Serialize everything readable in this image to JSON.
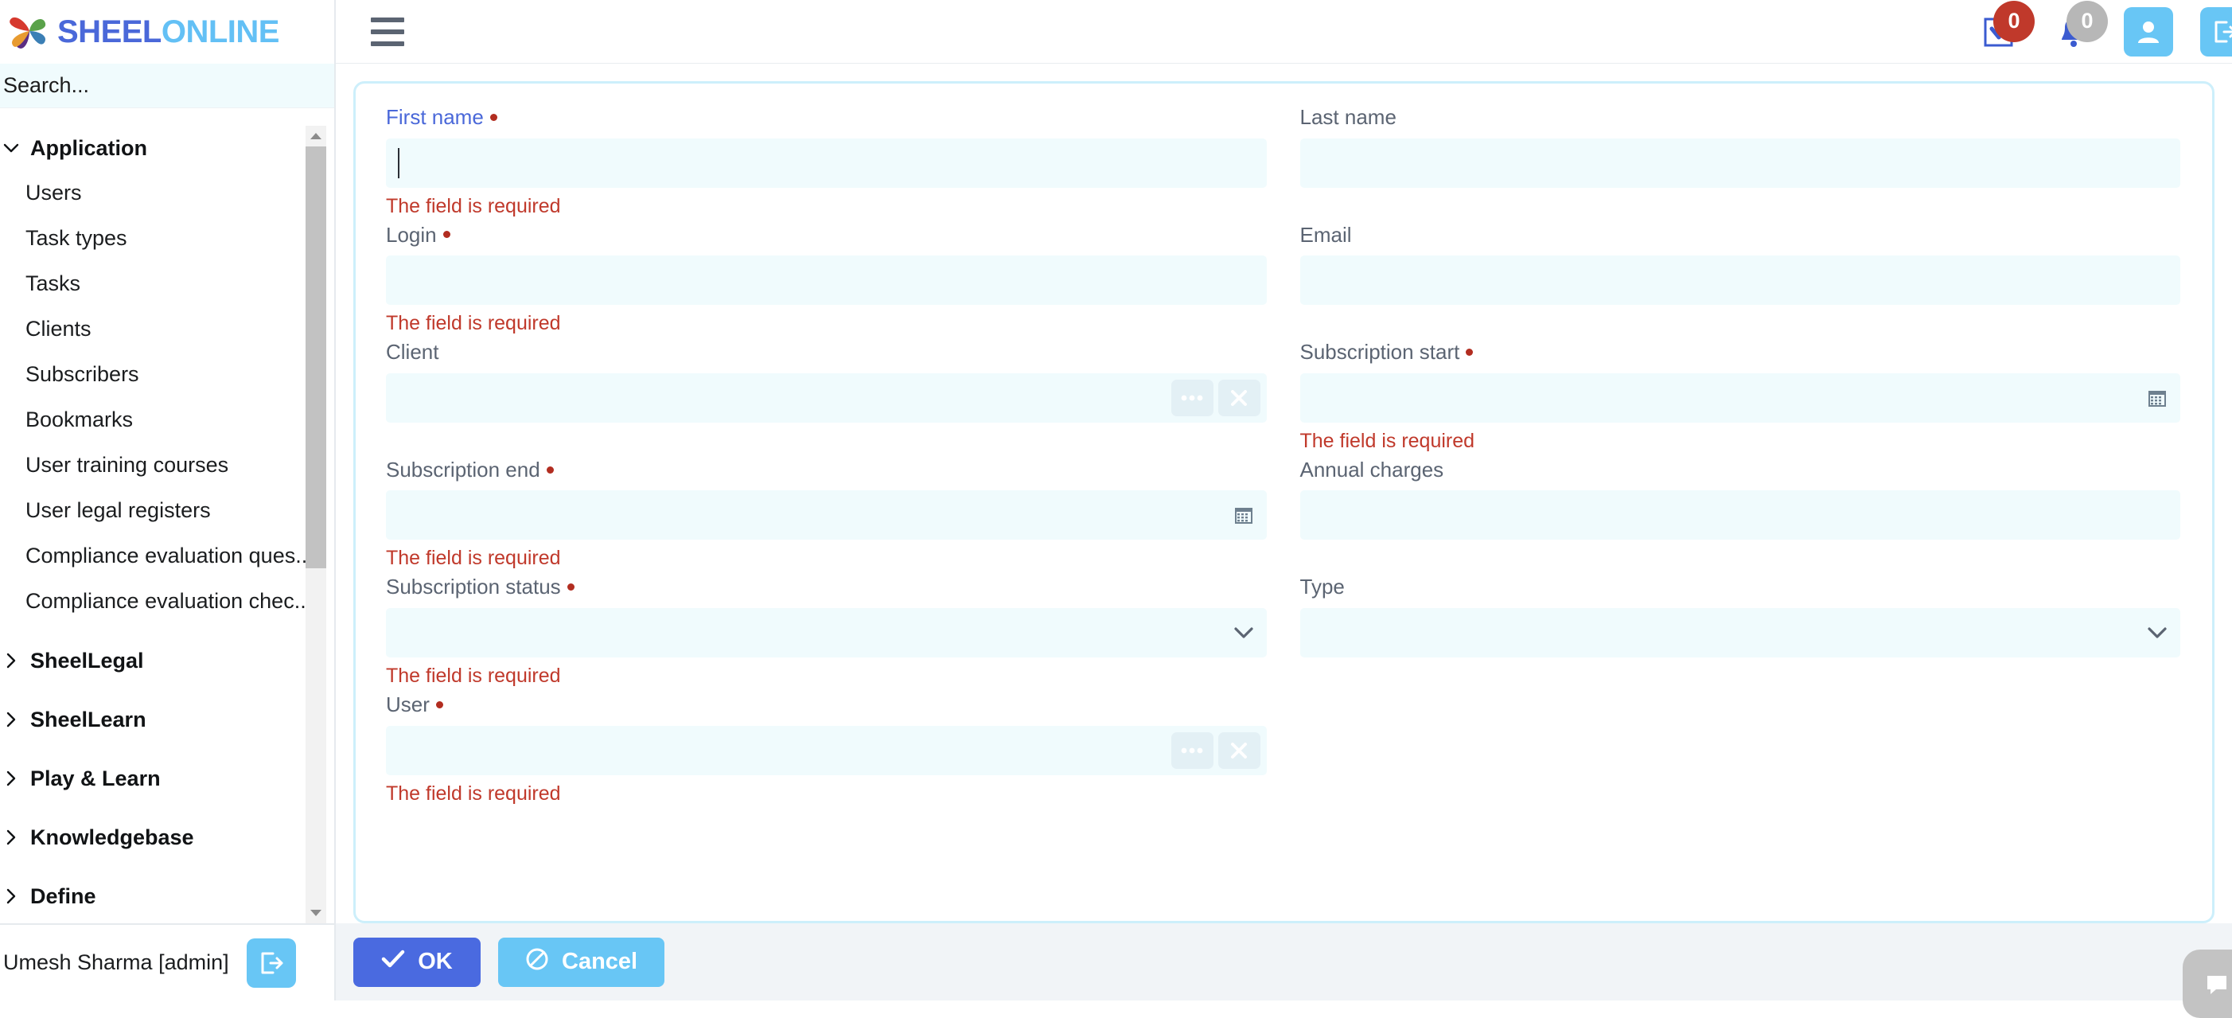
{
  "brand": {
    "name_part1": "SHEEL",
    "name_part2": "ONLINE",
    "color_part1": "#4a68d9",
    "color_part2": "#63c0f5",
    "logo_icon": "pinwheel-flower-icon"
  },
  "sidebar": {
    "search": {
      "placeholder": "Search...",
      "value": ""
    },
    "groups": [
      {
        "label": "Application",
        "expanded": true,
        "icon": "chevron-down-icon"
      },
      {
        "label": "SheelLegal",
        "expanded": false,
        "icon": "chevron-right-icon"
      },
      {
        "label": "SheelLearn",
        "expanded": false,
        "icon": "chevron-right-icon"
      },
      {
        "label": "Play & Learn",
        "expanded": false,
        "icon": "chevron-right-icon"
      },
      {
        "label": "Knowledgebase",
        "expanded": false,
        "icon": "chevron-right-icon"
      },
      {
        "label": "Define",
        "expanded": false,
        "icon": "chevron-right-icon"
      }
    ],
    "application_items": [
      {
        "label": "Users"
      },
      {
        "label": "Task types"
      },
      {
        "label": "Tasks"
      },
      {
        "label": "Clients"
      },
      {
        "label": "Subscribers"
      },
      {
        "label": "Bookmarks"
      },
      {
        "label": "User training courses"
      },
      {
        "label": "User legal registers"
      },
      {
        "label": "Compliance evaluation ques..."
      },
      {
        "label": "Compliance evaluation chec..."
      }
    ],
    "footer": {
      "user_label": "Umesh Sharma [admin]",
      "logout_icon": "logout-icon"
    }
  },
  "topbar": {
    "menu_icon": "hamburger-menu-icon",
    "tasks": {
      "icon": "checkbox-task-icon",
      "badge": "0",
      "badge_color": "#c0392b"
    },
    "notifications": {
      "icon": "bell-icon",
      "badge": "0",
      "badge_color": "#b7b7b7"
    },
    "profile": {
      "icon": "user-icon"
    },
    "logout": {
      "icon": "logout-icon"
    }
  },
  "form": {
    "error_text": "The field is required",
    "fields": {
      "first_name": {
        "label": "First name",
        "required": true,
        "value": "",
        "focused": true,
        "error": "The field is required"
      },
      "last_name": {
        "label": "Last name",
        "required": false,
        "value": "",
        "focused": false,
        "error": ""
      },
      "login": {
        "label": "Login",
        "required": true,
        "value": "",
        "focused": false,
        "error": "The field is required"
      },
      "email": {
        "label": "Email",
        "required": false,
        "value": "",
        "focused": false,
        "error": ""
      },
      "client": {
        "label": "Client",
        "required": false,
        "value": "",
        "focused": false,
        "error": "",
        "browse_icon": "ellipsis-icon",
        "clear_icon": "close-x-icon"
      },
      "subscription_start": {
        "label": "Subscription start",
        "required": true,
        "value": "",
        "focused": false,
        "error": "The field is required",
        "picker_icon": "calendar-icon"
      },
      "subscription_end": {
        "label": "Subscription end",
        "required": true,
        "value": "",
        "focused": false,
        "error": "The field is required",
        "picker_icon": "calendar-icon"
      },
      "annual_charges": {
        "label": "Annual charges",
        "required": false,
        "value": "",
        "focused": false,
        "error": ""
      },
      "subscription_status": {
        "label": "Subscription status",
        "required": true,
        "value": "",
        "focused": false,
        "error": "The field is required",
        "dropdown_icon": "chevron-down-icon"
      },
      "type": {
        "label": "Type",
        "required": false,
        "value": "",
        "focused": false,
        "error": "",
        "dropdown_icon": "chevron-down-icon"
      },
      "user": {
        "label": "User",
        "required": true,
        "value": "",
        "focused": false,
        "error": "The field is required",
        "browse_icon": "ellipsis-icon",
        "clear_icon": "close-x-icon"
      }
    }
  },
  "actions": {
    "ok_label": "OK",
    "ok_icon": "check-icon",
    "ok_color": "#4a6ae0",
    "cancel_label": "Cancel",
    "cancel_icon": "prohibition-icon",
    "cancel_color": "#68c6f5",
    "fab_icon": "chat-bubble-icon"
  }
}
